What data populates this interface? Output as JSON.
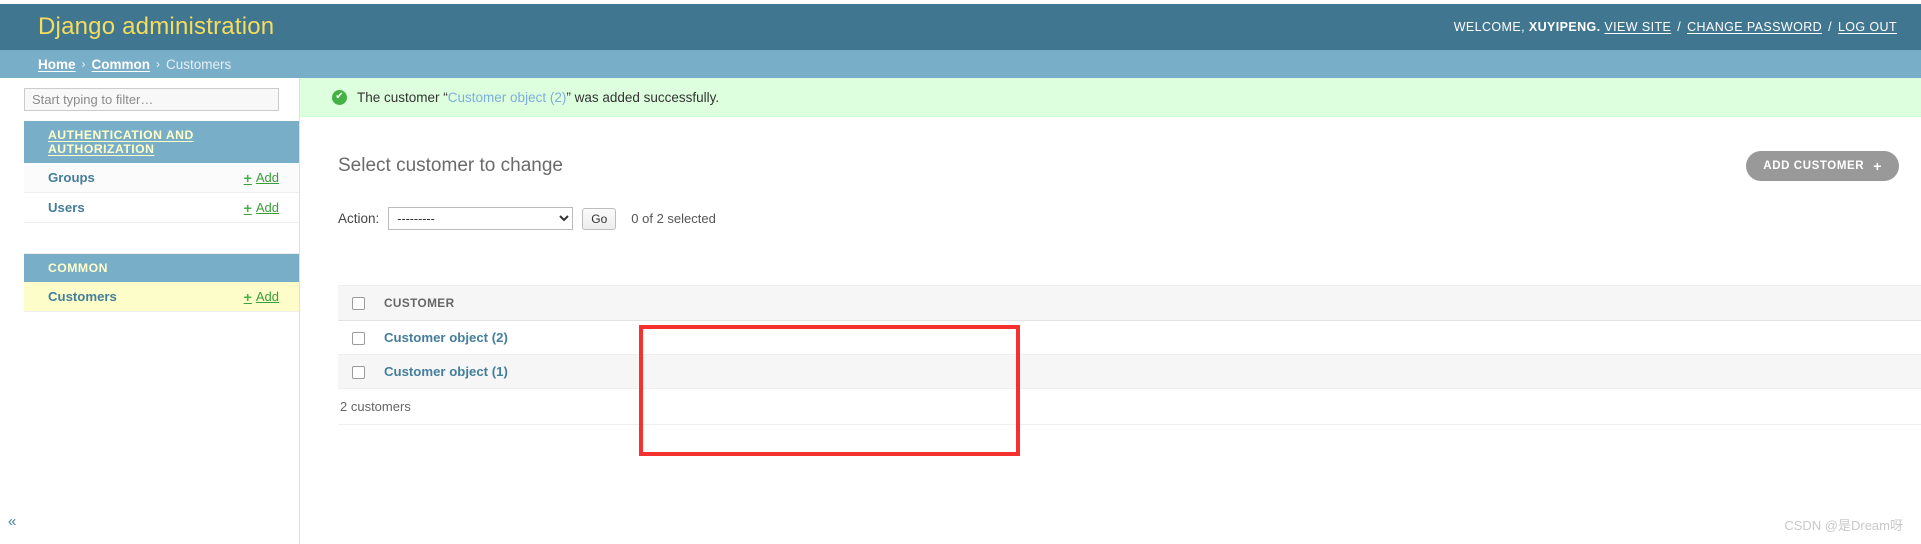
{
  "header": {
    "branding": "Django administration",
    "welcome_label": "WELCOME,",
    "username": "XUYIPENG.",
    "view_site": "VIEW SITE",
    "change_password": "CHANGE PASSWORD",
    "log_out": "LOG OUT",
    "separator": "/",
    "bg_color": "#417690",
    "branding_color": "#f5dd5d"
  },
  "breadcrumbs": {
    "home": "Home",
    "sep1": "›",
    "app": "Common",
    "sep2": "›",
    "current": "Customers",
    "bg_color": "#79aec8"
  },
  "sidebar": {
    "filter_placeholder": "Start typing to filter…",
    "filter_value": "",
    "collapse_icon": "«",
    "apps": [
      {
        "caption": "AUTHENTICATION AND AUTHORIZATION",
        "models": [
          {
            "name": "Groups",
            "add_label": "Add",
            "add_icon": "+",
            "current": false
          },
          {
            "name": "Users",
            "add_label": "Add",
            "add_icon": "+",
            "current": false
          }
        ]
      },
      {
        "caption": "COMMON",
        "models": [
          {
            "name": "Customers",
            "add_label": "Add",
            "add_icon": "+",
            "current": true
          }
        ]
      }
    ]
  },
  "message": {
    "icon": "success-check",
    "glyph": "✔",
    "prefix": "The customer “",
    "link": "Customer object (2)",
    "suffix": "” was added successfully.",
    "bg_color": "#ddffdd"
  },
  "main": {
    "page_title": "Select customer to change",
    "add_button": "ADD CUSTOMER",
    "add_button_icon": "+",
    "action_label": "Action:",
    "action_selected": "---------",
    "action_options": [
      "---------"
    ],
    "go_button": "Go",
    "selected_count": "0 of 2 selected"
  },
  "table": {
    "columns": [
      "CUSTOMER"
    ],
    "rows": [
      {
        "name": "Customer object (2)"
      },
      {
        "name": "Customer object (1)"
      }
    ],
    "paginator": "2 customers"
  },
  "annotation": {
    "color": "#f4312f"
  },
  "watermark": {
    "text": "CSDN @是Dream呀"
  }
}
